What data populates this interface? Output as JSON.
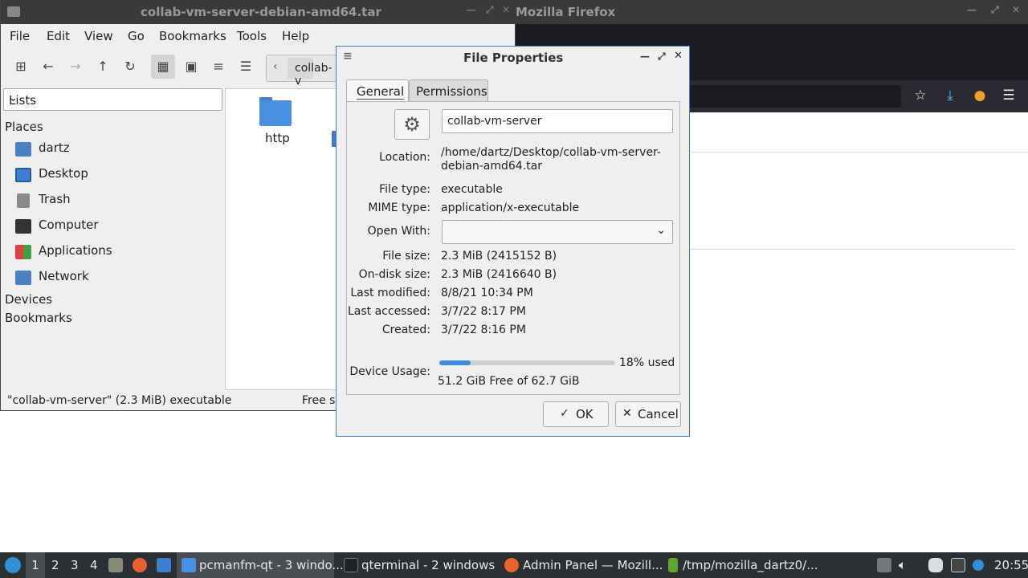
{
  "firefox": {
    "title": "Mozilla Firefox"
  },
  "filemanager": {
    "title": "collab-vm-server-debian-amd64.tar",
    "menu": [
      "File",
      "Edit",
      "View",
      "Go",
      "Bookmarks",
      "Tools",
      "Help"
    ],
    "path_text": "collab-v",
    "side_combo": "Lists",
    "places_header": "Places",
    "places": [
      {
        "label": "dartz",
        "icon": "home-folder-icon"
      },
      {
        "label": "Desktop",
        "icon": "desktop-icon"
      },
      {
        "label": "Trash",
        "icon": "trash-icon"
      },
      {
        "label": "Computer",
        "icon": "computer-icon"
      },
      {
        "label": "Applications",
        "icon": "applications-icon"
      },
      {
        "label": "Network",
        "icon": "network-icon"
      }
    ],
    "devices_header": "Devices",
    "bookmarks_header": "Bookmarks",
    "files": [
      {
        "name": "http",
        "icon": "folder-icon"
      }
    ],
    "status_left": "\"collab-vm-server\" (2.3 MiB) executable",
    "status_right": "Free s"
  },
  "dialog": {
    "title": "File Properties",
    "tabs": [
      "General",
      "Permissions"
    ],
    "name_value": "collab-vm-server",
    "labels": {
      "location": "Location:",
      "file_type": "File type:",
      "mime_type": "MIME type:",
      "open_with": "Open With:",
      "file_size": "File size:",
      "on_disk_size": "On-disk size:",
      "last_modified": "Last modified:",
      "last_accessed": "Last accessed:",
      "created": "Created:",
      "device_usage": "Device Usage:"
    },
    "values": {
      "location_line1": "/home/dartz/Desktop/collab-vm-server-",
      "location_line2": "debian-amd64.tar",
      "file_type": "executable",
      "mime_type": "application/x-executable",
      "open_with": "",
      "file_size": "2.3 MiB (2415152 B)",
      "on_disk_size": "2.3 MiB (2416640 B)",
      "last_modified": "8/8/21 10:34 PM",
      "last_accessed": "3/7/22 8:17 PM",
      "created": "3/7/22 8:16 PM",
      "usage_percent_label": "18% used",
      "usage_fraction": 0.18,
      "free_text": "51.2 GiB Free of 62.7 GiB"
    },
    "ok_label": "OK",
    "cancel_label": "Cancel"
  },
  "taskbar": {
    "workspaces": [
      "1",
      "2",
      "3",
      "4"
    ],
    "active_workspace": "1",
    "tasks": [
      {
        "label": "pcmanfm-qt - 3 windo...",
        "active": true
      },
      {
        "label": "qterminal - 2 windows",
        "active": false
      },
      {
        "label": "Admin Panel — Mozill...",
        "active": false
      },
      {
        "label": "/tmp/mozilla_dartz0/...",
        "active": false
      }
    ],
    "clock": "20:55"
  },
  "colors": {
    "accent": "#3d7cc9",
    "folder": "#4a90d9",
    "taskbar": "#2d3033",
    "ff_dark": "#1c1b22"
  }
}
